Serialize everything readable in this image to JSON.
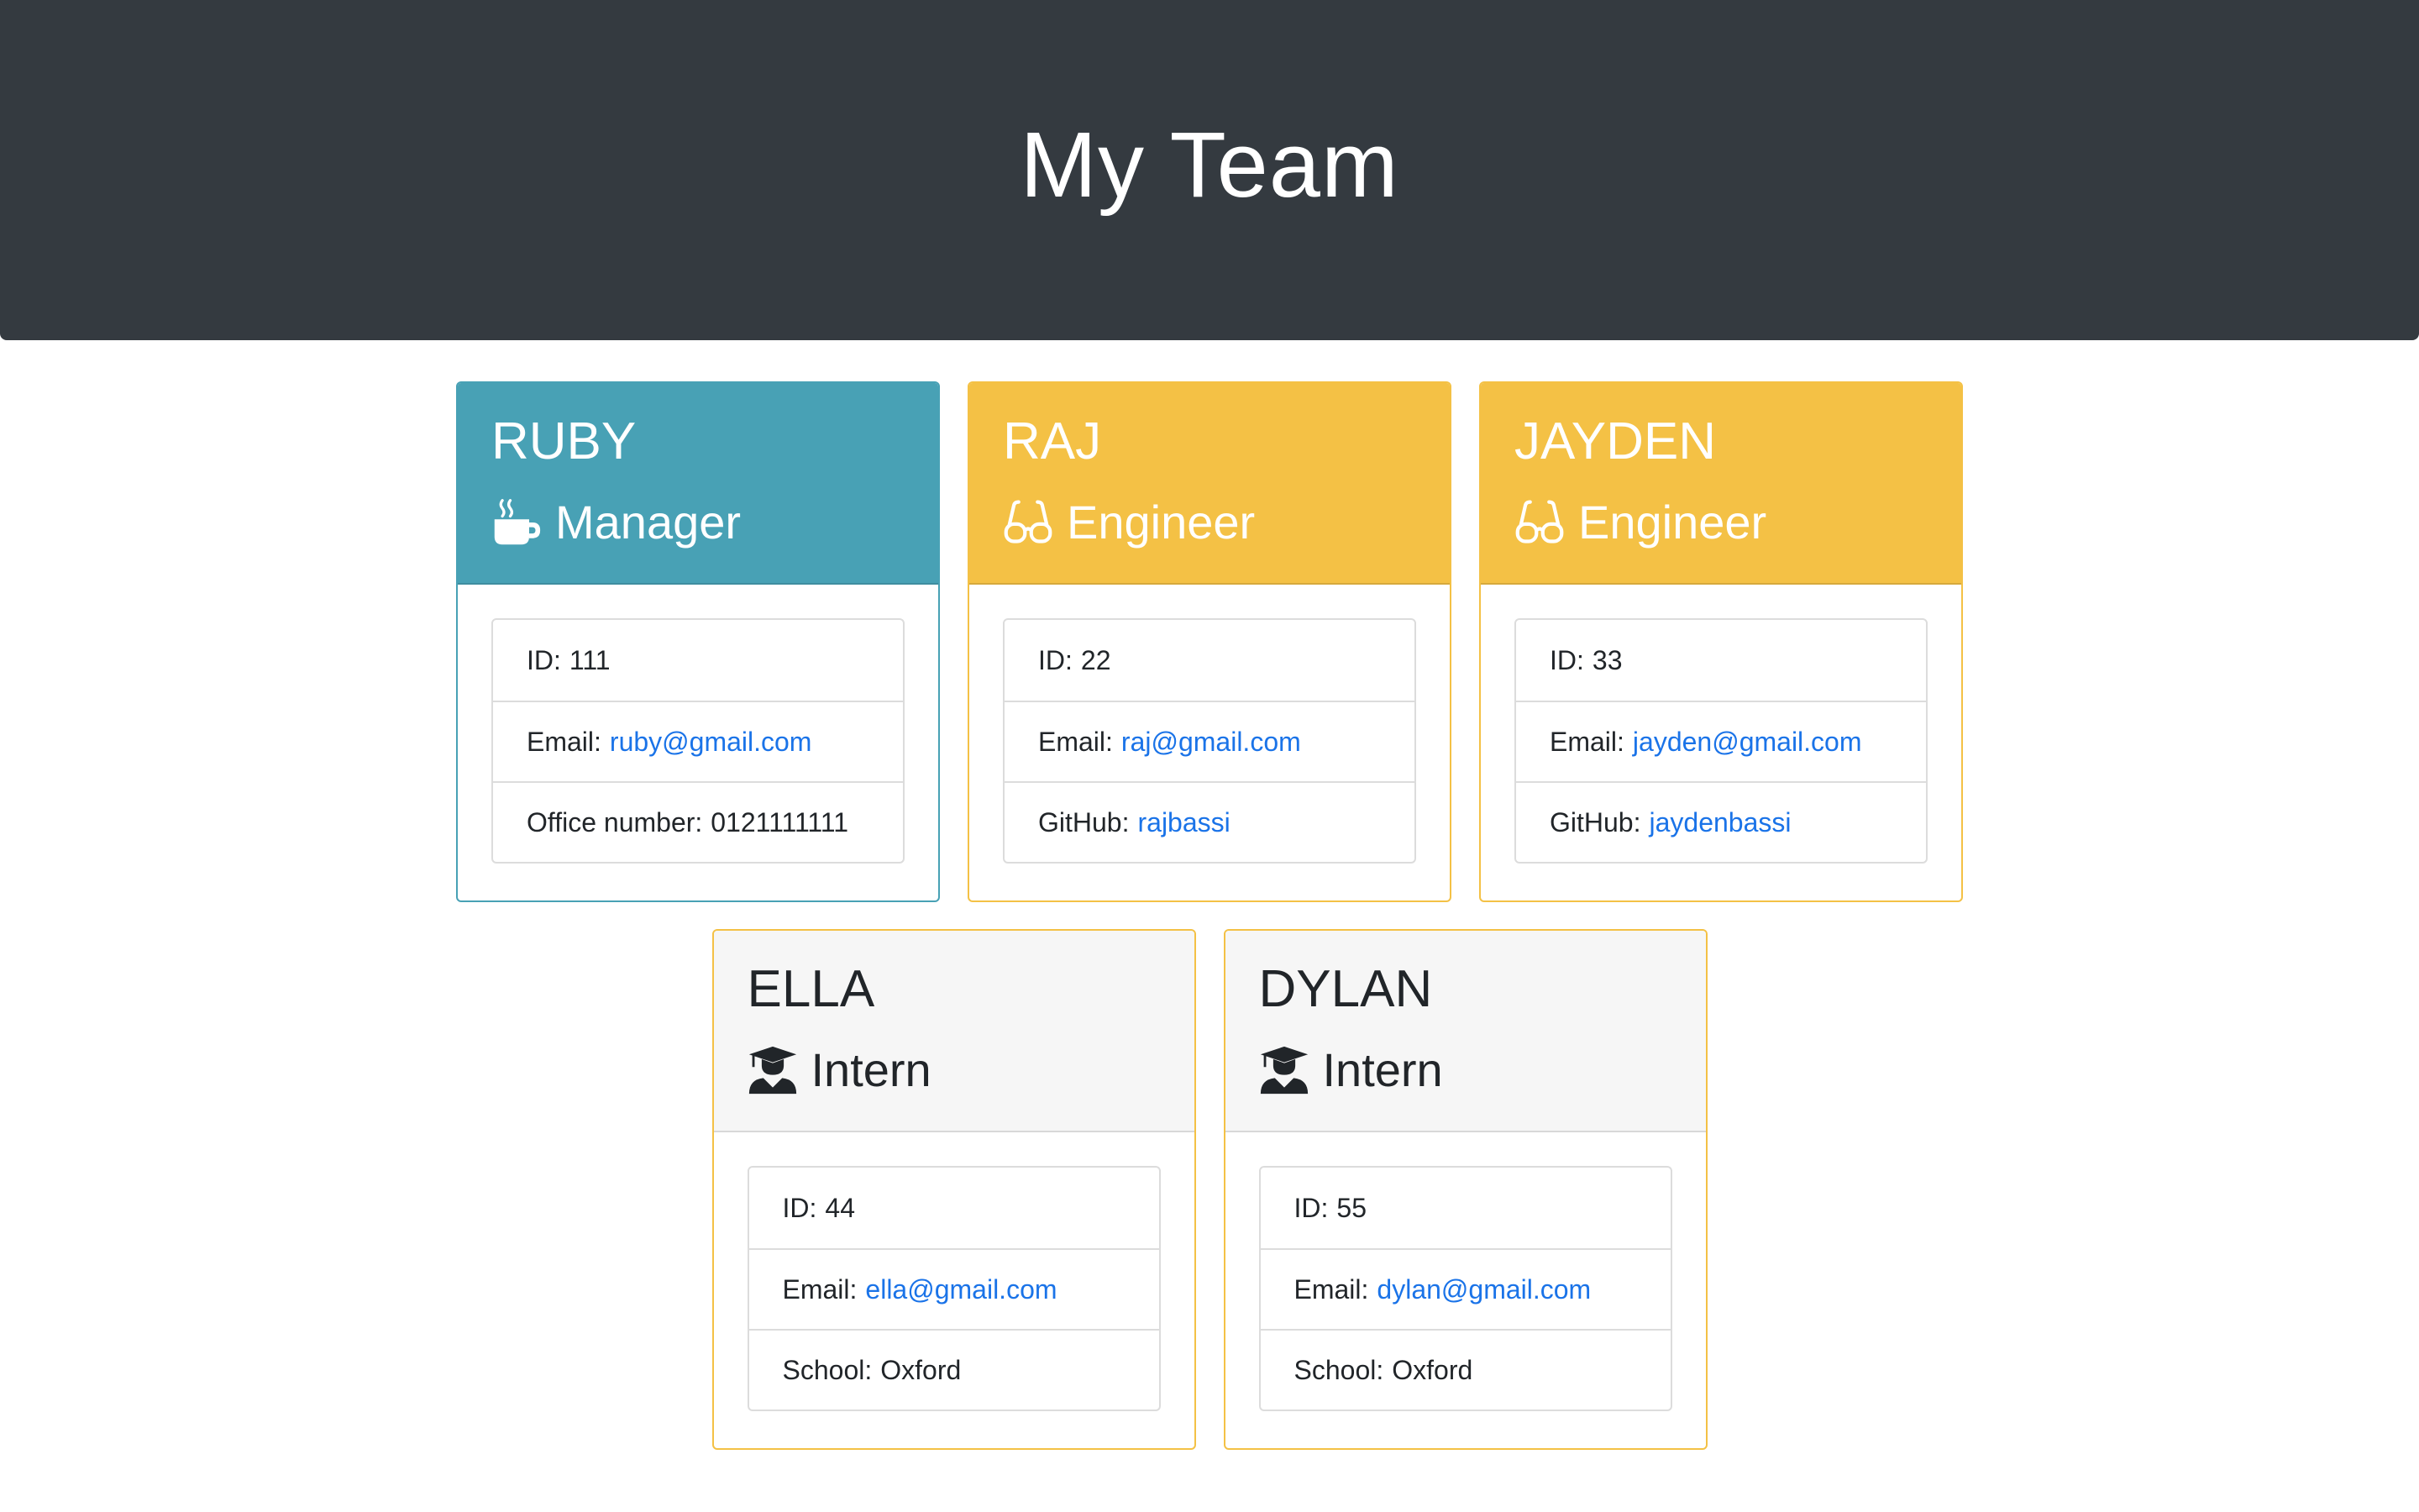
{
  "header": {
    "title": "My Team"
  },
  "colors": {
    "header_bg": "#343a40",
    "manager": "#48a1b5",
    "engineer": "#f4c145",
    "intern_head": "#f6f6f6",
    "link": "#1a73e8"
  },
  "cards": [
    {
      "name": "RUBY",
      "role": "Manager",
      "icon": "coffee-mug-icon",
      "id_label": "ID:",
      "id_value": "111",
      "email_label": "Email:",
      "email_value": "ruby@gmail.com",
      "extra_label": "Office number:",
      "extra_value": "0121111111"
    },
    {
      "name": "RAJ",
      "role": "Engineer",
      "icon": "glasses-icon",
      "id_label": "ID:",
      "id_value": "22",
      "email_label": "Email:",
      "email_value": "raj@gmail.com",
      "extra_label": "GitHub:",
      "extra_value": "rajbassi"
    },
    {
      "name": "JAYDEN",
      "role": "Engineer",
      "icon": "glasses-icon",
      "id_label": "ID:",
      "id_value": "33",
      "email_label": "Email:",
      "email_value": "jayden@gmail.com",
      "extra_label": "GitHub:",
      "extra_value": "jaydenbassi"
    },
    {
      "name": "ELLA",
      "role": "Intern",
      "icon": "graduate-icon",
      "id_label": "ID:",
      "id_value": "44",
      "email_label": "Email:",
      "email_value": "ella@gmail.com",
      "extra_label": "School:",
      "extra_value": "Oxford"
    },
    {
      "name": "DYLAN",
      "role": "Intern",
      "icon": "graduate-icon",
      "id_label": "ID:",
      "id_value": "55",
      "email_label": "Email:",
      "email_value": "dylan@gmail.com",
      "extra_label": "School:",
      "extra_value": "Oxford"
    }
  ]
}
